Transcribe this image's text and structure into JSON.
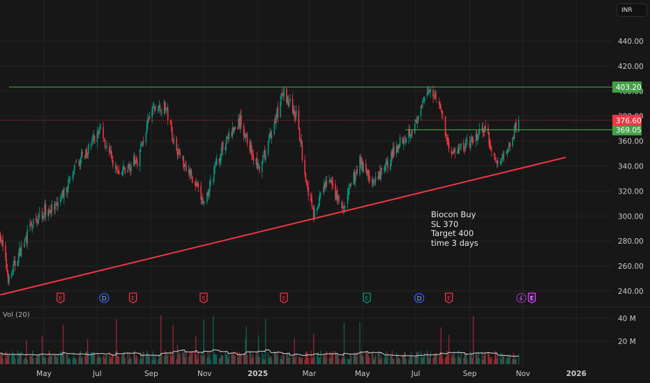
{
  "currency_button": "INR",
  "volume_label": "Vol (20)",
  "annotation": [
    "Biocon Buy",
    "SL 370",
    "Target 400",
    "time 3 days"
  ],
  "colors": {
    "background": "#171717",
    "up": "#089981",
    "down": "#f23645",
    "grid": "#242424",
    "level_line": "#4caf50",
    "trendline": "#f23645",
    "last_price": "#f23645"
  },
  "chart_data": {
    "type": "candlestick",
    "ylim": [
      230,
      450
    ],
    "y_ticks": [
      "440.00",
      "420.00",
      "400.00",
      "380.00",
      "360.00",
      "340.00",
      "320.00",
      "300.00",
      "280.00",
      "260.00",
      "240.00"
    ],
    "volume_ticks": [
      "40 M",
      "20 M"
    ],
    "x_ticks": [
      {
        "label": "May",
        "date": "2024-05-01"
      },
      {
        "label": "Jul",
        "date": "2024-07-01"
      },
      {
        "label": "Sep",
        "date": "2024-09-01"
      },
      {
        "label": "Nov",
        "date": "2024-11-01"
      },
      {
        "label": "2025",
        "date": "2025-01-01",
        "bold": true
      },
      {
        "label": "Mar",
        "date": "2025-03-01"
      },
      {
        "label": "May",
        "date": "2025-05-01"
      },
      {
        "label": "Jul",
        "date": "2025-07-01"
      },
      {
        "label": "Sep",
        "date": "2025-09-01"
      },
      {
        "label": "Nov",
        "date": "2025-11-01"
      },
      {
        "label": "2026",
        "date": "2026-01-01",
        "bold": true
      }
    ],
    "price_path": [
      [
        "2024-03-12",
        285
      ],
      [
        "2024-03-22",
        248
      ],
      [
        "2024-04-01",
        268
      ],
      [
        "2024-04-15",
        290
      ],
      [
        "2024-05-01",
        305
      ],
      [
        "2024-05-15",
        305
      ],
      [
        "2024-06-07",
        340
      ],
      [
        "2024-07-05",
        370
      ],
      [
        "2024-07-17",
        345
      ],
      [
        "2024-07-26",
        333
      ],
      [
        "2024-08-16",
        345
      ],
      [
        "2024-09-02",
        385
      ],
      [
        "2024-09-17",
        388
      ],
      [
        "2024-09-29",
        355
      ],
      [
        "2024-10-15",
        335
      ],
      [
        "2024-10-31",
        310
      ],
      [
        "2024-11-24",
        360
      ],
      [
        "2024-12-12",
        375
      ],
      [
        "2025-01-03",
        335
      ],
      [
        "2025-01-18",
        370
      ],
      [
        "2025-01-31",
        400
      ],
      [
        "2025-02-14",
        380
      ],
      [
        "2025-02-24",
        335
      ],
      [
        "2025-03-06",
        300
      ],
      [
        "2025-03-22",
        330
      ],
      [
        "2025-04-09",
        305
      ],
      [
        "2025-04-28",
        345
      ],
      [
        "2025-05-14",
        325
      ],
      [
        "2025-05-28",
        340
      ],
      [
        "2025-06-13",
        360
      ],
      [
        "2025-07-03",
        375
      ],
      [
        "2025-07-15",
        402
      ],
      [
        "2025-07-27",
        395
      ],
      [
        "2025-08-04",
        365
      ],
      [
        "2025-08-12",
        350
      ],
      [
        "2025-09-05",
        360
      ],
      [
        "2025-09-17",
        370
      ],
      [
        "2025-09-25",
        355
      ],
      [
        "2025-10-03",
        340
      ],
      [
        "2025-10-15",
        355
      ],
      [
        "2025-10-27",
        376.6
      ]
    ],
    "last_price": "376.60",
    "horizontal_levels": [
      {
        "label": "403.20",
        "price": 403.2,
        "from": "2024-03-22"
      },
      {
        "label": "369.05",
        "price": 369.05,
        "from": "2025-06-19"
      }
    ],
    "trendline": {
      "from": [
        "2024-03-12",
        237
      ],
      "to": [
        "2025-12-20",
        347
      ]
    },
    "events": [
      {
        "type": "E",
        "date": "2024-05-20",
        "color": "#f23645"
      },
      {
        "type": "D",
        "date": "2024-07-09",
        "color": "#2962ff"
      },
      {
        "type": "E",
        "date": "2024-08-11",
        "color": "#f23645"
      },
      {
        "type": "E",
        "date": "2024-10-31",
        "color": "#f23645"
      },
      {
        "type": "E",
        "date": "2025-01-31",
        "color": "#f23645"
      },
      {
        "type": "E",
        "date": "2025-05-06",
        "color": "#089981"
      },
      {
        "type": "D",
        "date": "2025-07-05",
        "color": "#2962ff"
      },
      {
        "type": "E",
        "date": "2025-08-08",
        "color": "#f23645"
      },
      {
        "type": "split",
        "date": "2025-10-30",
        "color": "#9c27b0"
      },
      {
        "type": "E",
        "date": "2025-11-11",
        "color": "#e040fb"
      }
    ]
  }
}
